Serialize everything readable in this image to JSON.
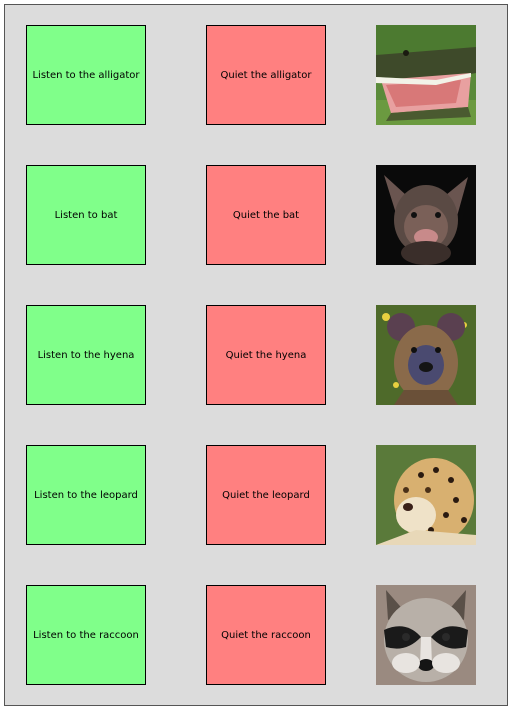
{
  "colors": {
    "panel_bg": "#dcdcdc",
    "listen_bg": "#80ff8a",
    "quiet_bg": "#ff8080"
  },
  "rows": [
    {
      "listen_label": "Listen to the alligator",
      "quiet_label": "Quiet the alligator",
      "animal_icon": "alligator-photo"
    },
    {
      "listen_label": "Listen to bat",
      "quiet_label": "Quiet the bat",
      "animal_icon": "bat-photo"
    },
    {
      "listen_label": "Listen to the hyena",
      "quiet_label": "Quiet the hyena",
      "animal_icon": "hyena-photo"
    },
    {
      "listen_label": "Listen to the leopard",
      "quiet_label": "Quiet the leopard",
      "animal_icon": "leopard-photo"
    },
    {
      "listen_label": "Listen to the raccoon",
      "quiet_label": "Quiet the raccoon",
      "animal_icon": "raccoon-photo"
    }
  ]
}
